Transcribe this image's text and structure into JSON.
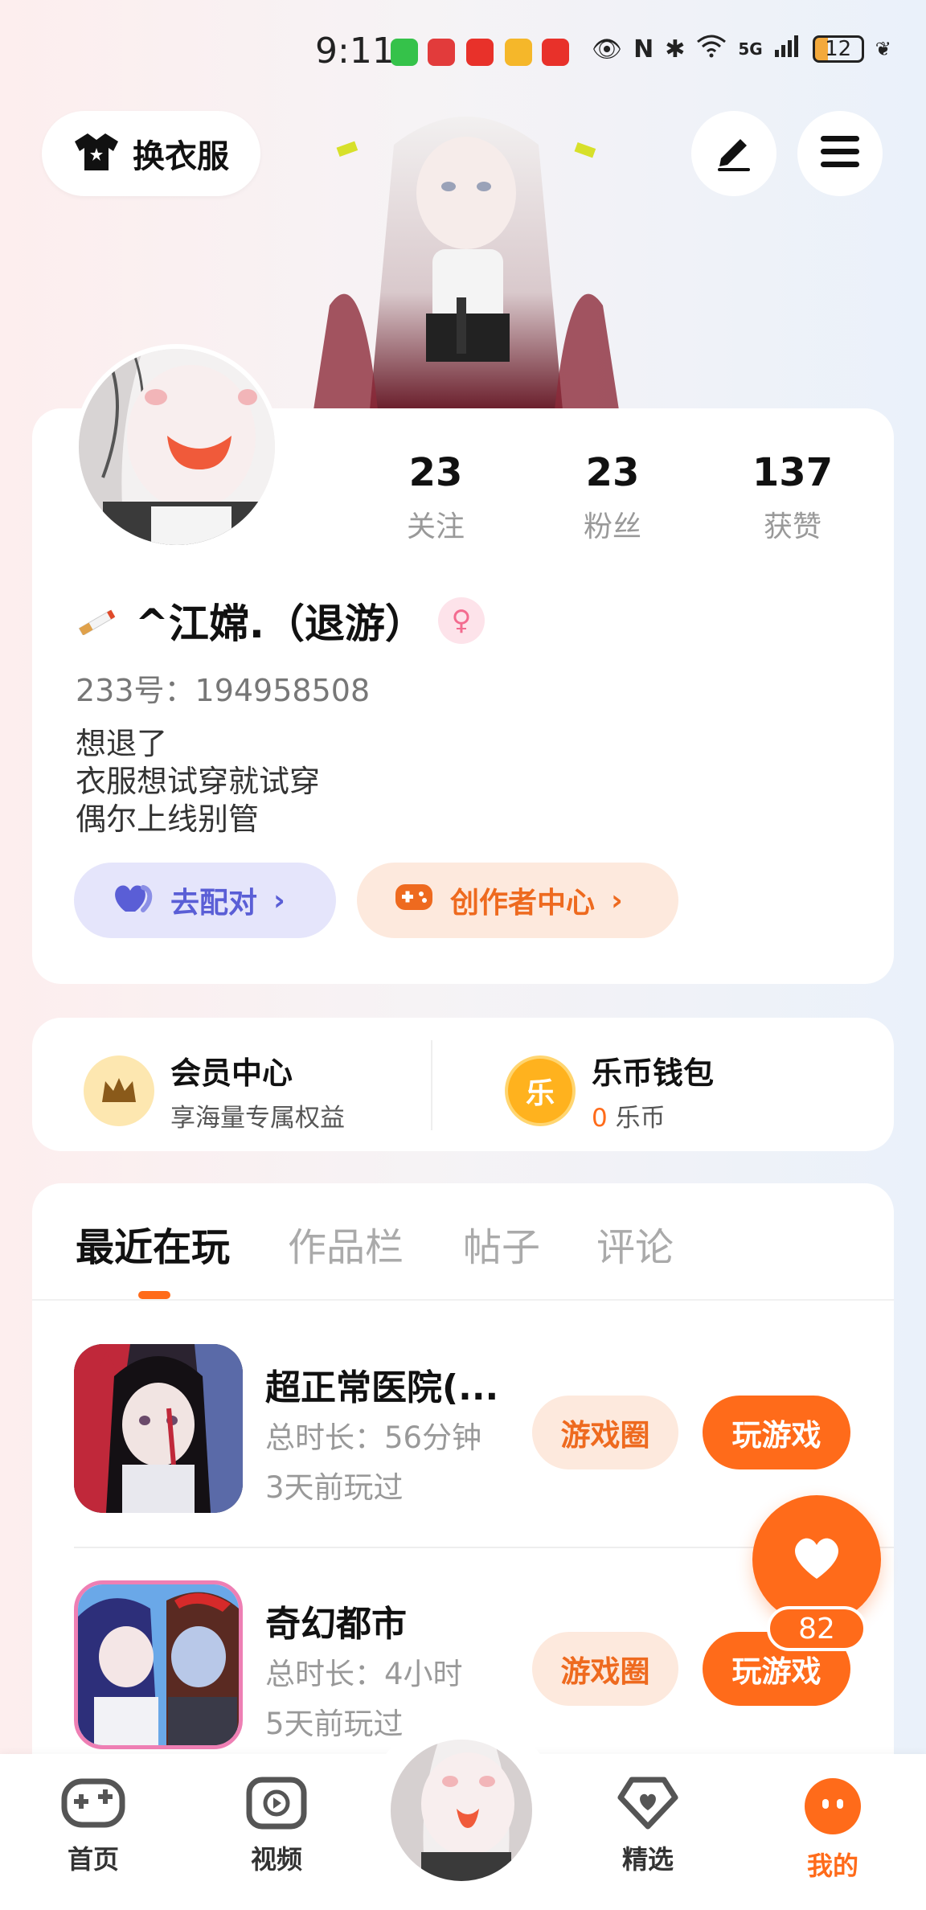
{
  "status_bar": {
    "time": "9:11",
    "network": "5G",
    "battery": "12"
  },
  "header": {
    "outfit_label": "换衣服",
    "edit_icon": "edit-pen-icon",
    "menu_icon": "menu-icon"
  },
  "profile": {
    "stats": [
      {
        "value": "23",
        "label": "关注"
      },
      {
        "value": "23",
        "label": "粉丝"
      },
      {
        "value": "137",
        "label": "获赞"
      }
    ],
    "name": "^江嫦.（退游）",
    "gender_symbol": "♀",
    "uid": "233号：194958508",
    "bio": [
      "想退了",
      "衣服想试穿就试穿",
      "偶尔上线别管"
    ],
    "match_label": "去配对",
    "creator_label": "创作者中心"
  },
  "member": {
    "vip_title": "会员中心",
    "vip_sub": "享海量专属权益",
    "wallet_title": "乐币钱包",
    "wallet_icon_char": "乐",
    "wallet_amount": "0",
    "wallet_unit": "乐币"
  },
  "tabs": [
    "最近在玩",
    "作品栏",
    "帖子",
    "评论"
  ],
  "games": [
    {
      "title": "超正常医院(...",
      "duration": "总时长：56分钟",
      "last": "3天前玩过",
      "circle_label": "游戏圈",
      "play_label": "玩游戏"
    },
    {
      "title": "奇幻都市",
      "duration": "总时长：4小时",
      "last": "5天前玩过",
      "circle_label": "游戏圈",
      "play_label": "玩游戏"
    }
  ],
  "fab": {
    "count": "82"
  },
  "nav": [
    {
      "label": "首页"
    },
    {
      "label": "视频"
    },
    {
      "label": "精选"
    },
    {
      "label": "我的"
    }
  ],
  "colors": {
    "accent": "#ff6b1a",
    "match": "#5a5ed6",
    "gender": "#f36b8f"
  }
}
